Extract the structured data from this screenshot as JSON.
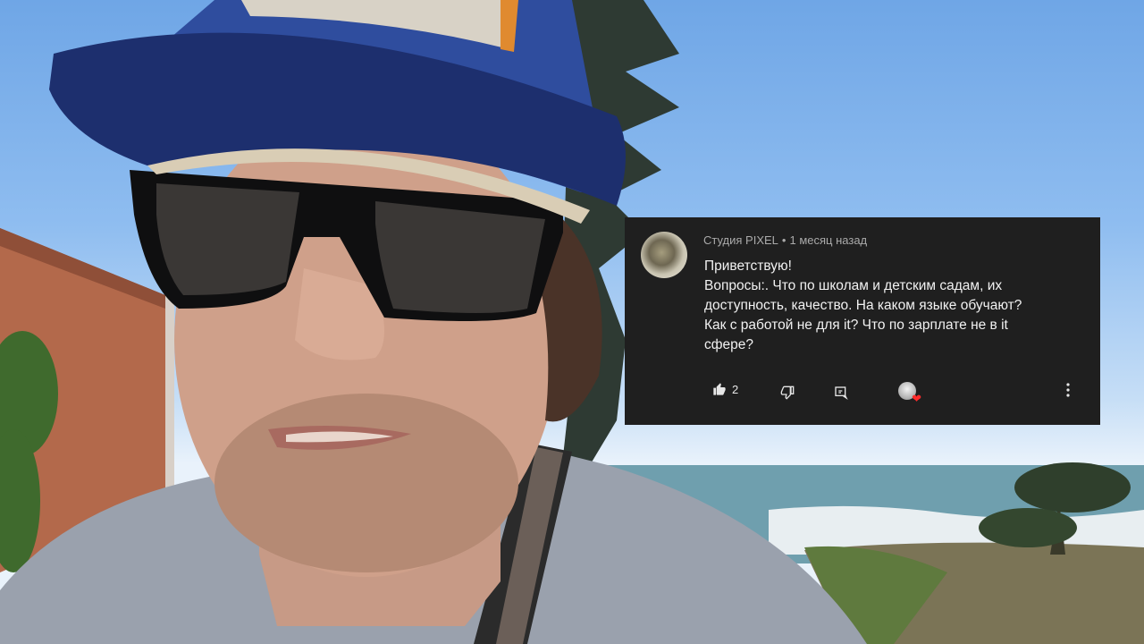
{
  "comment": {
    "author": "Студия PIXEL",
    "time": "1 месяц назад",
    "separator": "•",
    "lines": [
      "Приветствую!",
      "Вопросы:. Что по школам и детским садам, их",
      "доступность, качество. На каком языке обучают?",
      "Как с работой не для it? Что по зарплате не в it",
      "сфере?"
    ],
    "like_count": "2",
    "icons": {
      "like": "thumbs-up-icon",
      "dislike": "thumbs-down-icon",
      "reply": "reply-icon",
      "creator_heart": "creator-heart-avatar",
      "more": "more-vert-icon"
    },
    "colors": {
      "card_bg": "#1f1f1f",
      "meta_text": "#aaaaaa",
      "body_text": "#f1f1f1",
      "heart": "#ff2b2b"
    }
  }
}
